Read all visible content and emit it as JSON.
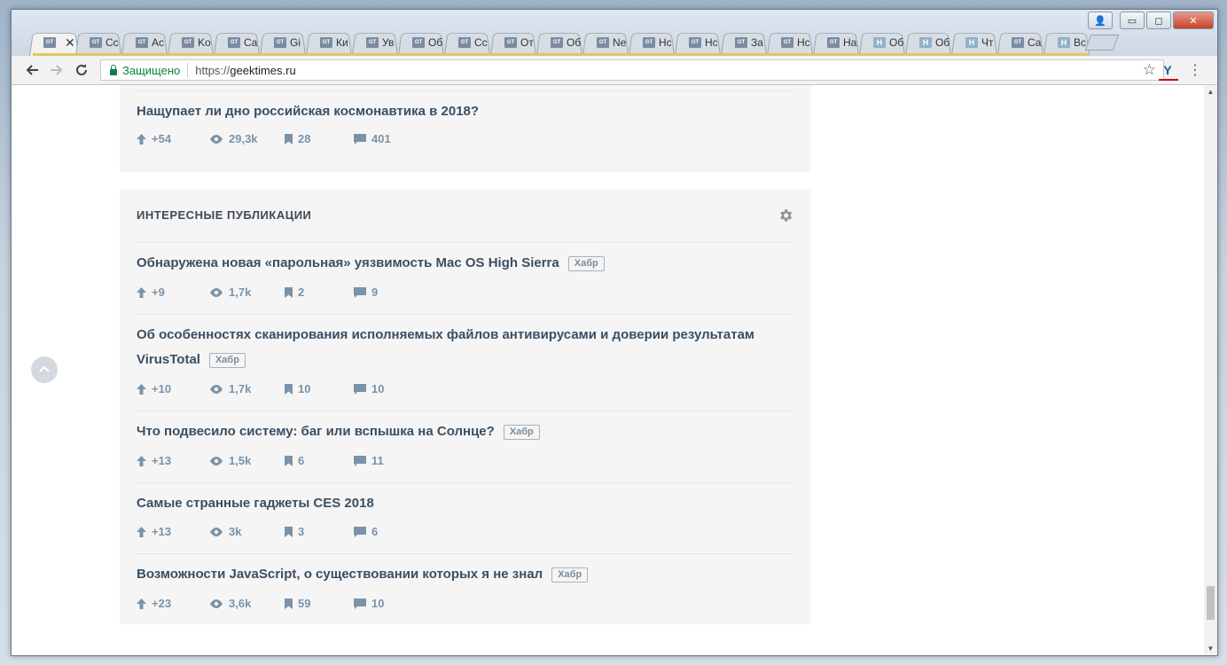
{
  "browser": {
    "tabs": [
      {
        "label": "",
        "icon": "gt",
        "active": true
      },
      {
        "label": "Cc",
        "icon": "gt"
      },
      {
        "label": "Ac",
        "icon": "gt"
      },
      {
        "label": "Ko",
        "icon": "gt"
      },
      {
        "label": "Ca",
        "icon": "gt"
      },
      {
        "label": "Gi",
        "icon": "gt"
      },
      {
        "label": "Ки",
        "icon": "gt"
      },
      {
        "label": "Ув",
        "icon": "gt"
      },
      {
        "label": "Об",
        "icon": "gt"
      },
      {
        "label": "Сс",
        "icon": "gt"
      },
      {
        "label": "От",
        "icon": "gt"
      },
      {
        "label": "Об",
        "icon": "gt"
      },
      {
        "label": "Ne",
        "icon": "gt"
      },
      {
        "label": "Нс",
        "icon": "gt"
      },
      {
        "label": "Нс",
        "icon": "gt"
      },
      {
        "label": "За",
        "icon": "gt"
      },
      {
        "label": "Нс",
        "icon": "gt"
      },
      {
        "label": "На",
        "icon": "gt"
      },
      {
        "label": "Об",
        "icon": "h"
      },
      {
        "label": "Об",
        "icon": "h"
      },
      {
        "label": "Чт",
        "icon": "h"
      },
      {
        "label": "Са",
        "icon": "gt"
      },
      {
        "label": "Вс",
        "icon": "h"
      }
    ],
    "favicon_gt": "GT",
    "favicon_h": "H",
    "tab_close_glyph": "✕",
    "window_buttons": {
      "minimize": "▭",
      "maximize": "◻",
      "close": "✕"
    },
    "security_label": "Защищено",
    "url_scheme": "https://",
    "url_host": "geektimes.ru",
    "extension_label": "Y",
    "accent_colors": {
      "secure": "#0b8043",
      "title_text": "#3b4f63",
      "stat_text": "#7a93a8"
    }
  },
  "top_post": {
    "title": "Нащупает ли дно российская космонавтика в 2018?",
    "rating": "+54",
    "views": "29,3k",
    "bookmarks": "28",
    "comments": "401"
  },
  "section": {
    "heading": "ИНТЕРЕСНЫЕ ПУБЛИКАЦИИ",
    "posts": [
      {
        "title": "Обнаружена новая «парольная» уязвимость Mac OS High Sierra",
        "tag": "Хабр",
        "rating": "+9",
        "views": "1,7k",
        "bookmarks": "2",
        "comments": "9"
      },
      {
        "title": "Об особенностях сканирования исполняемых файлов антивирусами и доверии результатам VirusTotal",
        "tag": "Хабр",
        "rating": "+10",
        "views": "1,7k",
        "bookmarks": "10",
        "comments": "10"
      },
      {
        "title": "Что подвесило систему: баг или вспышка на Солнце?",
        "tag": "Хабр",
        "rating": "+13",
        "views": "1,5k",
        "bookmarks": "6",
        "comments": "11"
      },
      {
        "title": "Самые странные гаджеты CES 2018",
        "tag": "",
        "rating": "+13",
        "views": "3k",
        "bookmarks": "3",
        "comments": "6"
      },
      {
        "title": "Возможности JavaScript, о существовании которых я не знал",
        "tag": "Хабр",
        "rating": "+23",
        "views": "3,6k",
        "bookmarks": "59",
        "comments": "10"
      }
    ]
  }
}
